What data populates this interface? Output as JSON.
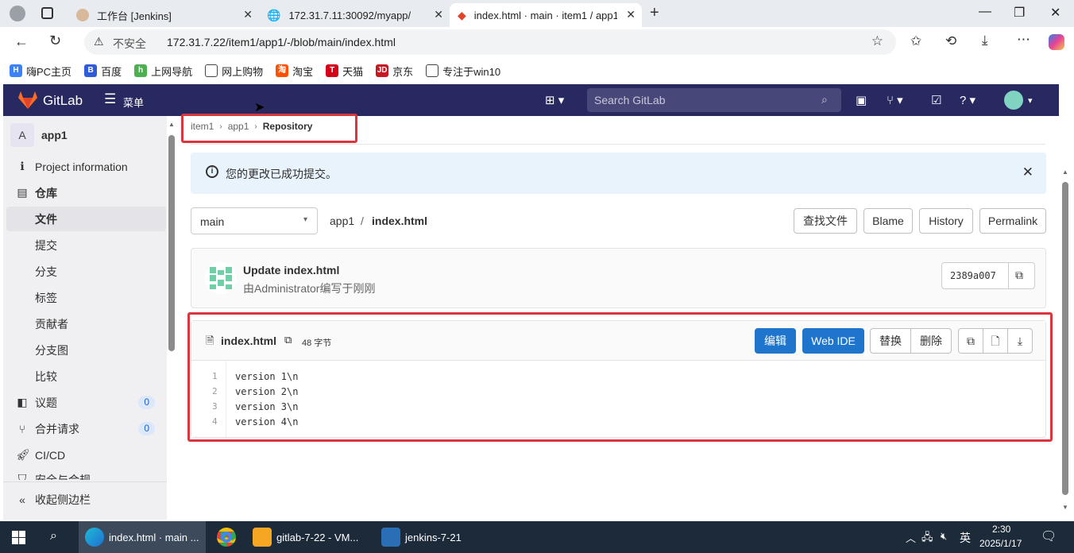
{
  "browser": {
    "tabs": [
      {
        "label": "工作台 [Jenkins]"
      },
      {
        "label": "172.31.7.11:30092/myapp/"
      },
      {
        "label": "index.html · main · item1 / app1 ·"
      }
    ],
    "security_label": "不安全",
    "url": "172.31.7.22/item1/app1/-/blob/main/index.html",
    "bookmarks": [
      "嗨PC主页",
      "百度",
      "上网导航",
      "网上购物",
      "淘宝",
      "天猫",
      "京东",
      "专注于win10"
    ]
  },
  "gitlab": {
    "brand": "GitLab",
    "menu_label": "菜单",
    "search_placeholder": "Search GitLab"
  },
  "sidebar": {
    "project_avatar": "A",
    "project_name": "app1",
    "items": [
      {
        "label": "Project information",
        "icon": "info-icon"
      },
      {
        "label": "仓库",
        "icon": "repository-icon"
      },
      {
        "label": "文件"
      },
      {
        "label": "提交"
      },
      {
        "label": "分支"
      },
      {
        "label": "标签"
      },
      {
        "label": "贡献者"
      },
      {
        "label": "分支图"
      },
      {
        "label": "比较"
      },
      {
        "label": "议题",
        "icon": "issues-icon",
        "count": "0"
      },
      {
        "label": "合并请求",
        "icon": "merge-request-icon",
        "count": "0"
      },
      {
        "label": "CI/CD",
        "icon": "rocket-icon"
      },
      {
        "label": "安全与合规",
        "icon": "shield-icon"
      }
    ],
    "collapse_label": "收起侧边栏"
  },
  "main": {
    "breadcrumb": [
      "item1",
      "app1",
      "Repository"
    ],
    "alert": "您的更改已成功提交。",
    "branch": "main",
    "path_dir": "app1",
    "path_sep": "/",
    "path_file": "index.html",
    "actions": [
      "查找文件",
      "Blame",
      "History",
      "Permalink"
    ],
    "commit": {
      "title": "Update index.html",
      "author_line": "由Administrator编写于刚刚",
      "sha": "2389a007"
    },
    "file": {
      "name": "index.html",
      "size": "48 字节",
      "edit_label": "编辑",
      "webide_label": "Web IDE",
      "replace_label": "替换",
      "delete_label": "删除",
      "lines": [
        {
          "num": "1",
          "text": "version 1\\n"
        },
        {
          "num": "2",
          "text": "version 2\\n"
        },
        {
          "num": "3",
          "text": "version 3\\n"
        },
        {
          "num": "4",
          "text": "version 4\\n"
        }
      ]
    }
  },
  "taskbar": {
    "items": [
      "index.html · main ...",
      "gitlab-7-22 - VM...",
      "jenkins-7-21"
    ],
    "ime": "英",
    "time": "2:30",
    "date": "2025/1/17"
  },
  "colors": {
    "header": "#292961",
    "primary": "#1f75cb",
    "highlight": "#d9363e",
    "alert_bg": "#e9f3fc"
  }
}
